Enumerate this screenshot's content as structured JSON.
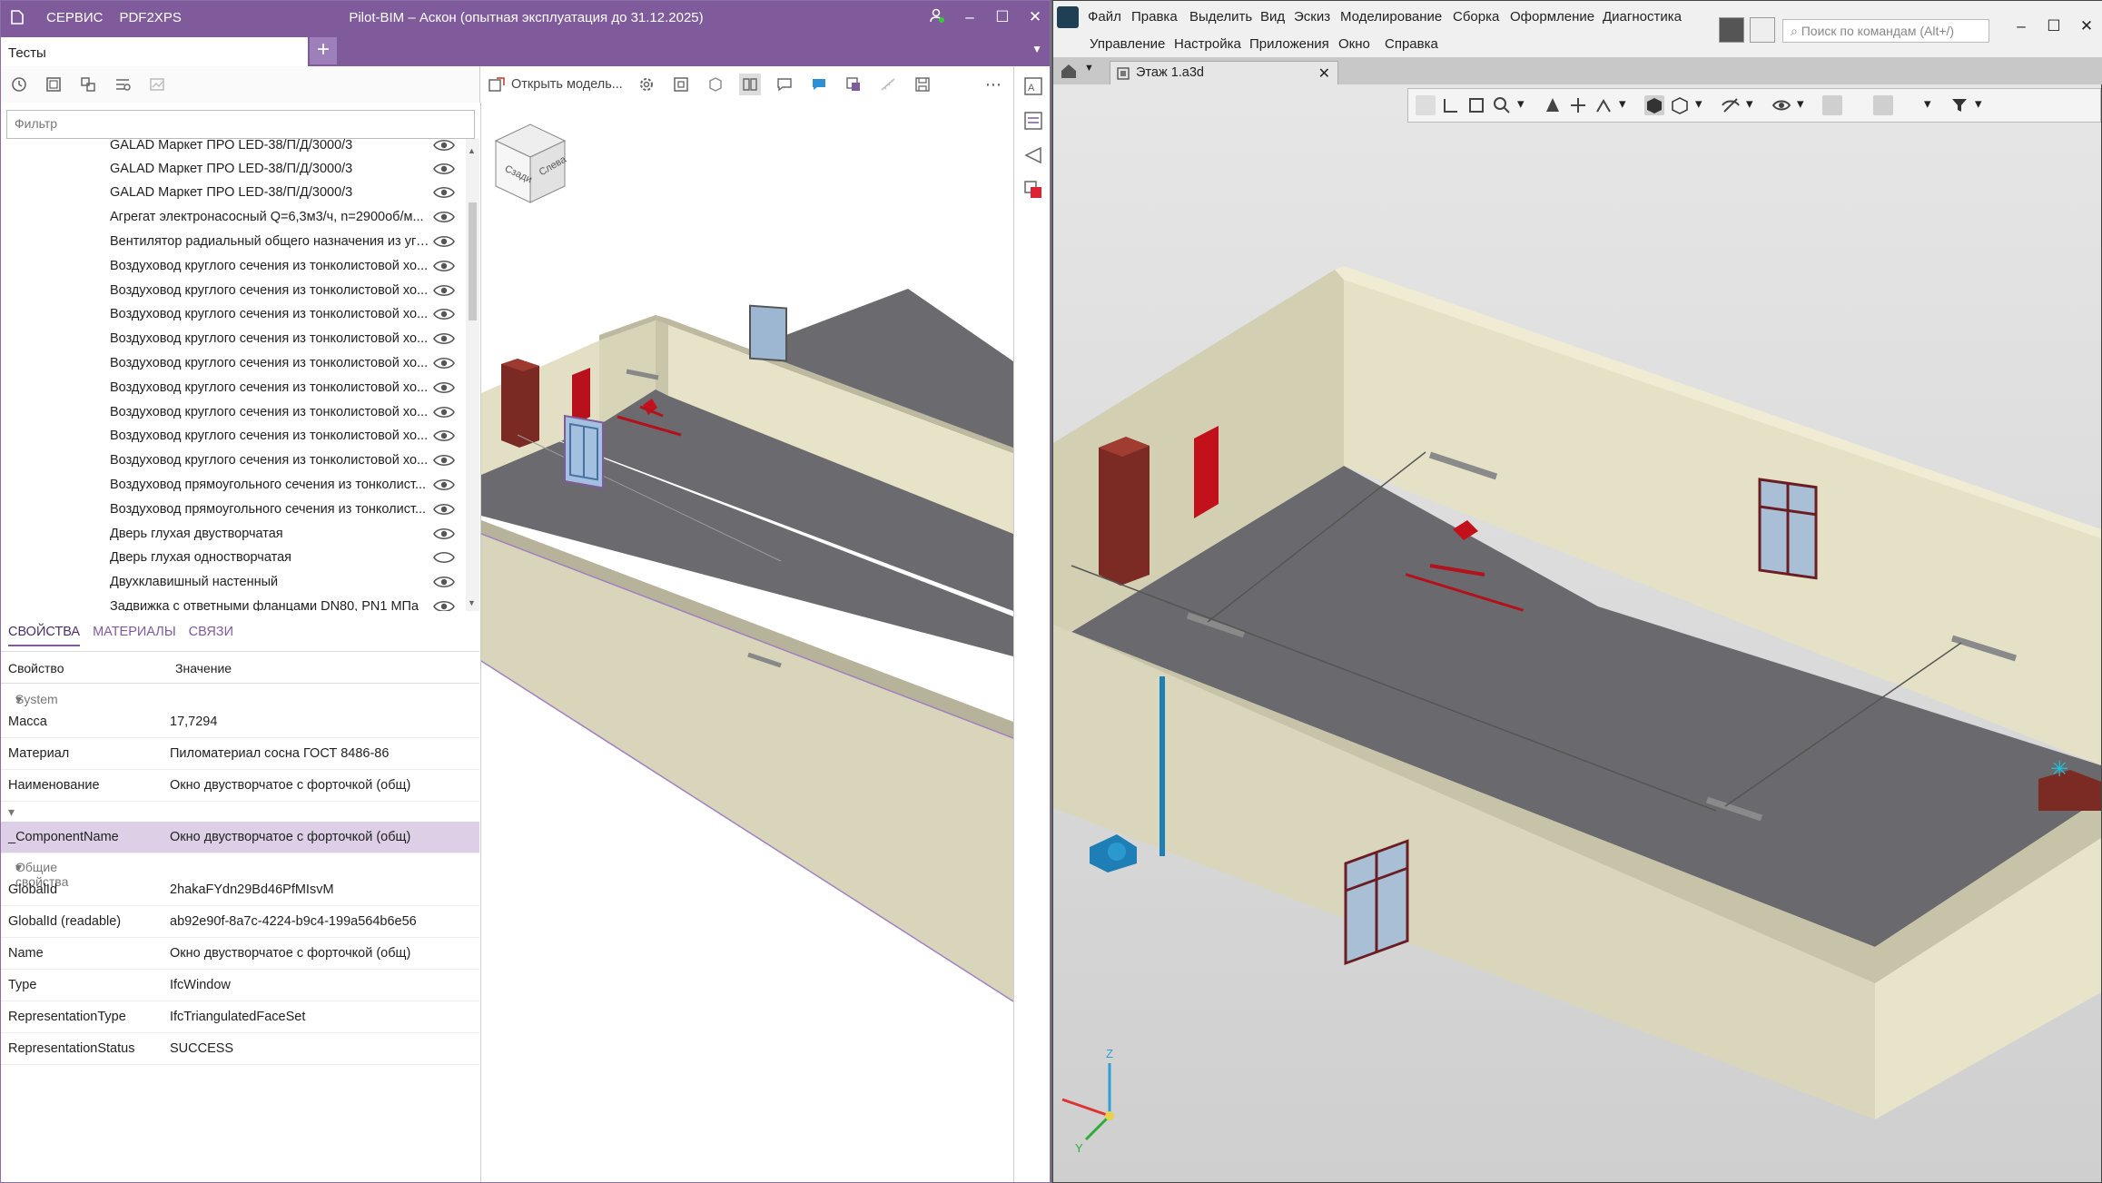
{
  "pilot": {
    "title": "Pilot-BIM – Аскон (опытная эксплуатация до 31.12.2025)",
    "menu": [
      "СЕРВИС",
      "PDF2XPS"
    ],
    "tab": "Тесты",
    "filter_placeholder": "Фильтр",
    "open_model": "Открыть модель...",
    "tree": [
      "GALAD Маркет ПРО LED-38/П/Д/3000/3",
      "GALAD Маркет ПРО LED-38/П/Д/3000/3",
      "GALAD Маркет ПРО LED-38/П/Д/3000/3",
      "Агрегат электронасосный Q=6,3м3/ч, n=2900об/м...",
      "Вентилятор радиальный общего назначения из угл...",
      "Воздуховод круглого сечения из тонколистовой хо...",
      "Воздуховод круглого сечения из тонколистовой хо...",
      "Воздуховод круглого сечения из тонколистовой хо...",
      "Воздуховод круглого сечения из тонколистовой хо...",
      "Воздуховод круглого сечения из тонколистовой хо...",
      "Воздуховод круглого сечения из тонколистовой хо...",
      "Воздуховод круглого сечения из тонколистовой хо...",
      "Воздуховод круглого сечения из тонколистовой хо...",
      "Воздуховод круглого сечения из тонколистовой хо...",
      "Воздуховод прямоугольного сечения из тонколист...",
      "Воздуховод прямоугольного сечения из тонколист...",
      "Дверь глухая двустворчатая",
      "Дверь глухая одностворчатая",
      "Двухклавишный  настенный",
      "Задвижка с ответными фланцами DN80, PN1 МПа"
    ],
    "props_tabs": [
      "СВОЙСТВА",
      "МАТЕРИАЛЫ",
      "СВЯЗИ"
    ],
    "props_header": {
      "key": "Свойство",
      "value": "Значение"
    },
    "groups": {
      "system": "System",
      "common": "Общие свойства"
    },
    "props_system": [
      {
        "k": "Масса",
        "v": "17,7294"
      },
      {
        "k": "Материал",
        "v": "Пиломатериал сосна ГОСТ 8486-86"
      },
      {
        "k": "Наименование",
        "v": "Окно двустворчатое с форточкой (общ)"
      }
    ],
    "props_component": {
      "k": "_ComponentName",
      "v": "Окно двустворчатое с форточкой (общ)"
    },
    "props_common": [
      {
        "k": "GlobalId",
        "v": "2hakaFYdn29Bd46PfMIsvM"
      },
      {
        "k": "GlobalId (readable)",
        "v": "ab92e90f-8a7c-4224-b9c4-199a564b6e56"
      },
      {
        "k": "Name",
        "v": "Окно двустворчатое с форточкой (общ)"
      },
      {
        "k": "Type",
        "v": "IfcWindow"
      },
      {
        "k": "RepresentationType",
        "v": "IfcTriangulatedFaceSet"
      },
      {
        "k": "RepresentationStatus",
        "v": "SUCCESS"
      }
    ],
    "viewcube_labels": [
      "Сзади",
      "Слева"
    ]
  },
  "kompas": {
    "menu_row1": [
      "Файл",
      "Правка",
      "Выделить",
      "Вид",
      "Эскиз",
      "Моделирование",
      "Сборка",
      "Оформление",
      "Диагностика"
    ],
    "menu_row2": [
      "Управление",
      "Настройка",
      "Приложения",
      "Окно",
      "Справка"
    ],
    "search_placeholder": "Поиск по командам (Alt+/)",
    "doc_tab": "Этаж 1.a3d",
    "axes": [
      "Z",
      "Y"
    ]
  },
  "colors": {
    "accent": "#7f5b9c",
    "selected_row": "#ddd0e6",
    "floor": "#6a6a6e",
    "wall": "#e7e3c9",
    "door": "#c3111c",
    "pipe": "#1d7fb5"
  }
}
